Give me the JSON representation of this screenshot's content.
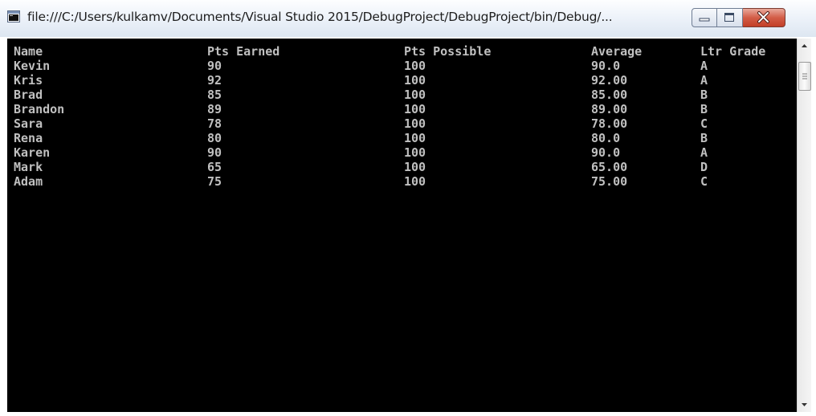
{
  "window": {
    "title": "file:///C:/Users/kulkamv/Documents/Visual Studio 2015/DebugProject/DebugProject/bin/Debug/..."
  },
  "console": {
    "headers": [
      "Name",
      "Pts Earned",
      "Pts Possible",
      "Average",
      "Ltr Grade"
    ],
    "rows": [
      [
        "Kevin",
        "90",
        "100",
        "90.0",
        "A"
      ],
      [
        "Kris",
        "92",
        "100",
        "92.00",
        "A"
      ],
      [
        "Brad",
        "85",
        "100",
        "85.00",
        "B"
      ],
      [
        "Brandon",
        "89",
        "100",
        "89.00",
        "B"
      ],
      [
        "Sara",
        "78",
        "100",
        "78.00",
        "C"
      ],
      [
        "Rena",
        "80",
        "100",
        "80.0",
        "B"
      ],
      [
        "Karen",
        "90",
        "100",
        "90.0",
        "A"
      ],
      [
        "Mark",
        "65",
        "100",
        "65.00",
        "D"
      ],
      [
        "Adam",
        "75",
        "100",
        "75.00",
        "C"
      ]
    ]
  },
  "icons": {
    "app": "console-app-icon",
    "minimize": "minimize-icon",
    "maximize": "maximize-icon",
    "close": "close-icon",
    "scroll_up": "chevron-up-icon",
    "scroll_down": "chevron-down-icon"
  },
  "colors": {
    "console_background": "#000000",
    "console_text": "#c0c0c0",
    "close_button": "#c94a33"
  }
}
